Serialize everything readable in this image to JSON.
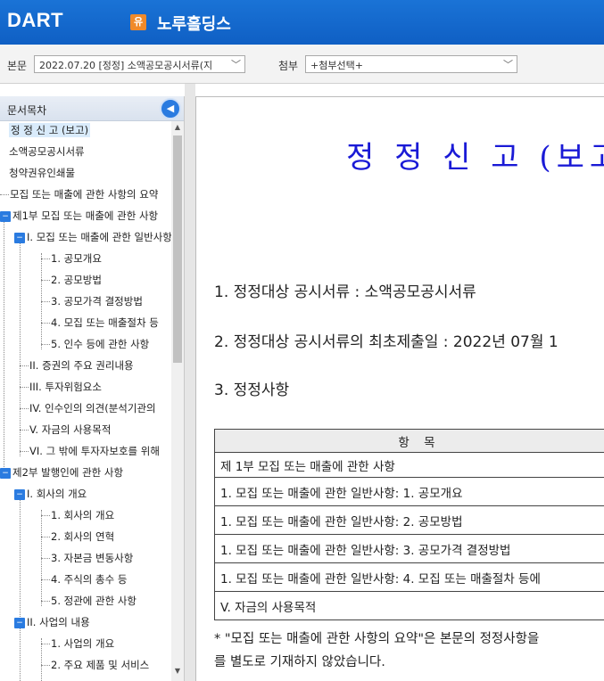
{
  "header": {
    "logo": "DART",
    "company_badge": "유",
    "company_name": "노루홀딩스"
  },
  "toolbar": {
    "body_label": "본문",
    "body_value": "2022.07.20  [정정] 소액공모공시서류(지",
    "attach_label": "첨부",
    "attach_value": "+첨부선택+"
  },
  "sidebar": {
    "title": "문서목차",
    "items": [
      {
        "label": "정 정 신 고 (보고)"
      },
      {
        "label": "소액공모공시서류"
      },
      {
        "label": "청약권유인쇄물"
      },
      {
        "label": "모집 또는 매출에 관한 사항의 요약"
      },
      {
        "label": "제1부 모집 또는 매출에 관한 사항"
      },
      {
        "label": "I. 모집 또는 매출에 관한 일반사항"
      },
      {
        "label": "1. 공모개요"
      },
      {
        "label": "2. 공모방법"
      },
      {
        "label": "3. 공모가격 결정방법"
      },
      {
        "label": "4. 모집 또는 매출절차 등"
      },
      {
        "label": "5. 인수 등에 관한 사항"
      },
      {
        "label": "II. 증권의 주요 권리내용"
      },
      {
        "label": "III. 투자위험요소"
      },
      {
        "label": "IV. 인수인의 의견(분석기관의"
      },
      {
        "label": "V. 자금의 사용목적"
      },
      {
        "label": "VI. 그 밖에 투자자보호를 위해"
      },
      {
        "label": "제2부 발행인에 관한 사항"
      },
      {
        "label": "I. 회사의 개요"
      },
      {
        "label": "1. 회사의 개요"
      },
      {
        "label": "2. 회사의 연혁"
      },
      {
        "label": "3. 자본금 변동사항"
      },
      {
        "label": "4. 주식의 총수 등"
      },
      {
        "label": "5. 정관에 관한 사항"
      },
      {
        "label": "II. 사업의 내용"
      },
      {
        "label": "1. 사업의 개요"
      },
      {
        "label": "2. 주요 제품 및 서비스"
      }
    ]
  },
  "document": {
    "title": "정 정 신 고 (보고",
    "line1": "1. 정정대상 공시서류 : 소액공모공시서류",
    "line2": "2. 정정대상 공시서류의 최초제출일 : 2022년 07월 1",
    "line3": "3. 정정사항",
    "table_header": "항 목",
    "table_rows": [
      "제 1부 모집 또는 매출에 관한 사항",
      "1. 모집  또는 매출에 관한 일반사항: 1. 공모개요",
      "1. 모집  또는 매출에 관한 일반사항: 2. 공모방법",
      "1. 모집  또는 매출에 관한 일반사항: 3. 공모가격 결정방법",
      "1. 모집  또는 매출에 관한 일반사항: 4. 모집 또는 매출절차 등에",
      "V. 자금의 사용목적"
    ],
    "note1": "* \"모집 또는 매출에 관한 사항의 요약\"은 본문의 정정사항을",
    "note2": "를 별도로 기재하지 않았습니다."
  }
}
